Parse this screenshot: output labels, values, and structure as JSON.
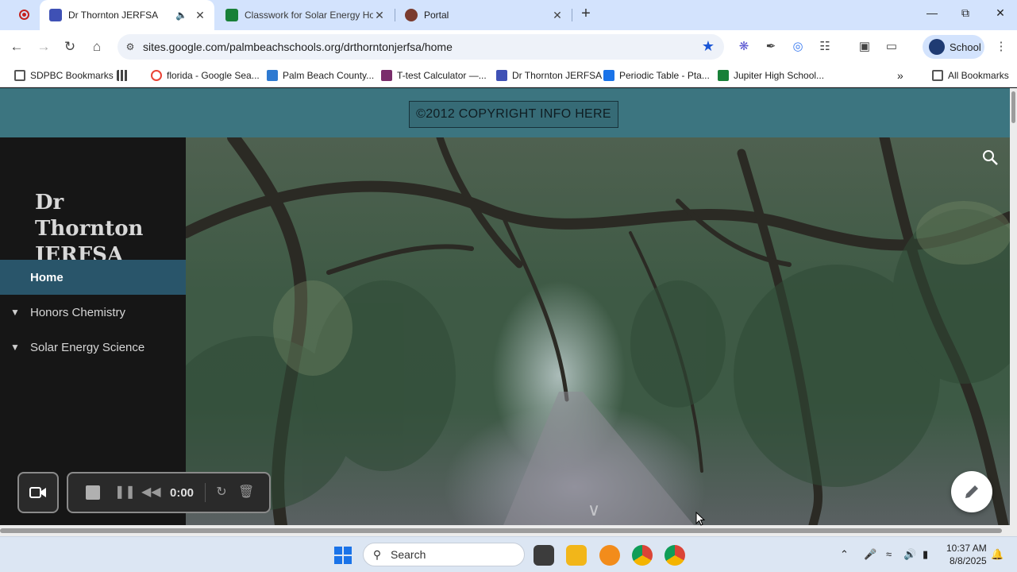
{
  "browser": {
    "tabs": [
      {
        "title": "Dr Thornton JERFSA",
        "active": true
      },
      {
        "title": "Classwork for Solar Energy Hon",
        "active": false
      },
      {
        "title": "Portal",
        "active": false
      }
    ],
    "new_tab_label": "+",
    "url": "sites.google.com/palmbeachschools.org/drthorntonjerfsa/home",
    "profile_label": "School"
  },
  "bookmarks": [
    {
      "label": "SDPBC Bookmarks"
    },
    {
      "label": "florida - Google Sea..."
    },
    {
      "label": "Palm Beach County..."
    },
    {
      "label": "T-test Calculator —..."
    },
    {
      "label": "Dr Thornton JERFSA"
    },
    {
      "label": "Periodic Table - Pta..."
    },
    {
      "label": "Jupiter High School..."
    }
  ],
  "all_bookmarks_label": "All Bookmarks",
  "site": {
    "copyright": "©2012 COPYRIGHT INFO HERE",
    "title": "Dr Thornton JERFSA",
    "nav": [
      {
        "label": "Home",
        "active": true
      },
      {
        "label": "Honors Chemistry",
        "active": false
      },
      {
        "label": "Solar Energy Science",
        "active": false
      }
    ]
  },
  "recorder": {
    "time": "0:00"
  },
  "taskbar": {
    "search_placeholder": "Search",
    "time": "10:37 AM",
    "date": "8/8/2025"
  },
  "colors": {
    "header": "#3c7580",
    "sidebar": "#161616",
    "nav_active": "#29556a",
    "tab_strip": "#d3e3fd",
    "bookmark_star": "#1a56d6"
  }
}
